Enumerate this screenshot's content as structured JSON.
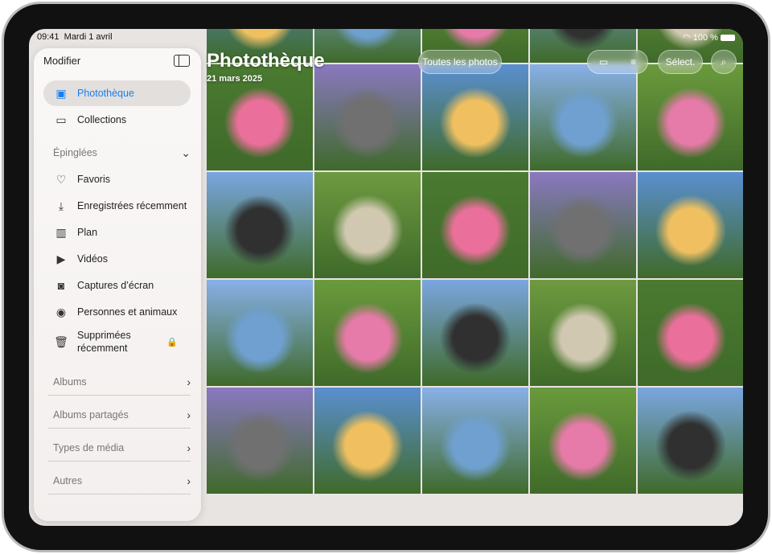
{
  "status": {
    "time": "09:41",
    "date": "Mardi 1 avril",
    "battery": "100 %"
  },
  "sidebar": {
    "edit_label": "Modifier",
    "items": [
      {
        "label": "Photothèque",
        "icon": "photo-library-icon"
      },
      {
        "label": "Collections",
        "icon": "collections-icon"
      }
    ],
    "pinned_label": "Épinglées",
    "pinned": [
      {
        "label": "Favoris",
        "icon": "heart-icon"
      },
      {
        "label": "Enregistrées récemment",
        "icon": "download-icon"
      },
      {
        "label": "Plan",
        "icon": "map-icon"
      },
      {
        "label": "Vidéos",
        "icon": "video-icon"
      },
      {
        "label": "Captures d’écran",
        "icon": "screenshot-icon"
      },
      {
        "label": "Personnes et animaux",
        "icon": "person-icon"
      },
      {
        "label": "Supprimées récemment",
        "icon": "trash-icon"
      }
    ],
    "sections": [
      "Albums",
      "Albums partagés",
      "Types de média",
      "Autres"
    ]
  },
  "header": {
    "title": "Photothèque",
    "date": "21 mars 2025",
    "filter": "Toutes les photos",
    "select": "Sélect."
  },
  "colors": {
    "accent": "#1a7ff0"
  }
}
